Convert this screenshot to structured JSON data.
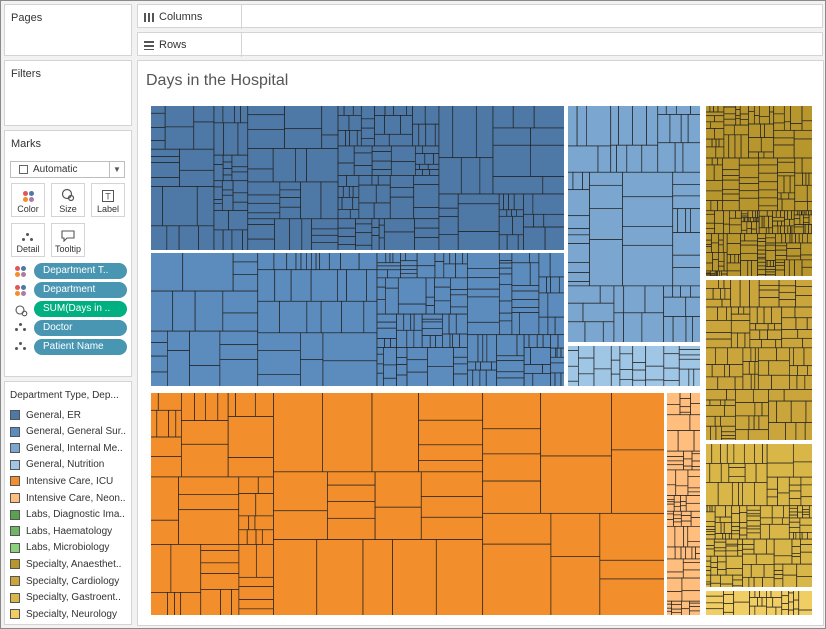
{
  "shelves": {
    "pages_title": "Pages",
    "filters_title": "Filters",
    "columns_label": "Columns",
    "rows_label": "Rows"
  },
  "marks": {
    "title": "Marks",
    "type_value": "Automatic",
    "buttons": {
      "color": "Color",
      "size": "Size",
      "label": "Label",
      "detail": "Detail",
      "tooltip": "Tooltip"
    },
    "pills": [
      {
        "label": "Department T..",
        "icon": "color-icon"
      },
      {
        "label": "Department",
        "icon": "color-icon"
      },
      {
        "label": "SUM(Days in ..",
        "icon": "size-icon"
      },
      {
        "label": "Doctor",
        "icon": "detail-icon"
      },
      {
        "label": "Patient Name",
        "icon": "detail-icon"
      }
    ]
  },
  "legend": {
    "title": "Department Type, Dep...",
    "items": [
      {
        "label": "General, ER",
        "color": "#4e79a7"
      },
      {
        "label": "General, General Sur..",
        "color": "#5b8cbd"
      },
      {
        "label": "General, Internal Me..",
        "color": "#7aa6cf"
      },
      {
        "label": "General, Nutrition",
        "color": "#a0c6e6"
      },
      {
        "label": "Intensive Care, ICU",
        "color": "#f28e2b"
      },
      {
        "label": "Intensive Care, Neon..",
        "color": "#ffbe7d"
      },
      {
        "label": "Labs, Diagnostic Ima..",
        "color": "#59a14f"
      },
      {
        "label": "Labs, Haematology",
        "color": "#6fb563"
      },
      {
        "label": "Labs, Microbiology",
        "color": "#8cd17d"
      },
      {
        "label": "Specialty, Anaesthet..",
        "color": "#b8962e"
      },
      {
        "label": "Specialty, Cardiology",
        "color": "#c9a53b"
      },
      {
        "label": "Specialty, Gastroent..",
        "color": "#d9b648"
      },
      {
        "label": "Specialty, Neurology",
        "color": "#f1ce63"
      }
    ]
  },
  "viz": {
    "title": "Days in the Hospital"
  },
  "treemap_colors": {
    "er": "#4e79a7",
    "surgery": "#5b8cbd",
    "internal_medicine": "#7aa6cf",
    "nutrition": "#a0c6e6",
    "icu": "#f28e2b",
    "neonatal": "#ffbe7d",
    "anaesthetics": "#b8962e",
    "cardiology": "#c9a53b",
    "gastroenterology": "#d9b648",
    "neurology": "#f1ce63"
  }
}
